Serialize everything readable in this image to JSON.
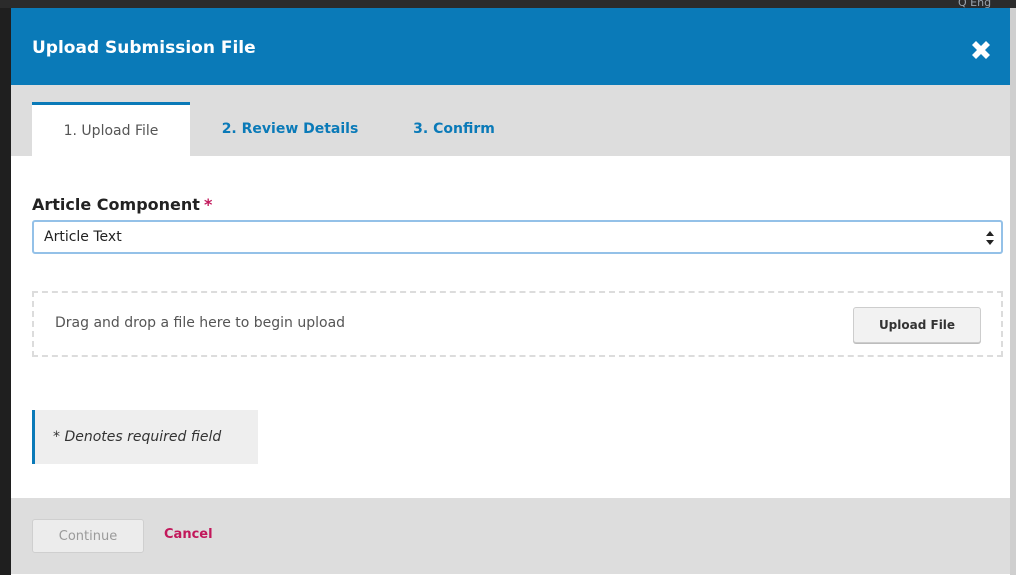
{
  "backdrop": {
    "corner_text": "Q Eng"
  },
  "modal": {
    "title": "Upload Submission File",
    "colors": {
      "header": "#0a7ab8",
      "accent_pink": "#c2185b"
    }
  },
  "tabs": [
    {
      "label": "1. Upload File",
      "active": true
    },
    {
      "label": "2. Review Details",
      "active": false
    },
    {
      "label": "3. Confirm",
      "active": false
    }
  ],
  "form": {
    "component_label": "Article Component",
    "required_mark": "*",
    "component_select": {
      "selected": "Article Text"
    }
  },
  "dropzone": {
    "text": "Drag and drop a file here to begin upload",
    "button_label": "Upload File"
  },
  "notice": {
    "text": "* Denotes required field"
  },
  "footer": {
    "continue_label": "Continue",
    "cancel_label": "Cancel"
  },
  "icons": {
    "close": "close-icon",
    "select_arrows": "chevron-updown-icon"
  }
}
